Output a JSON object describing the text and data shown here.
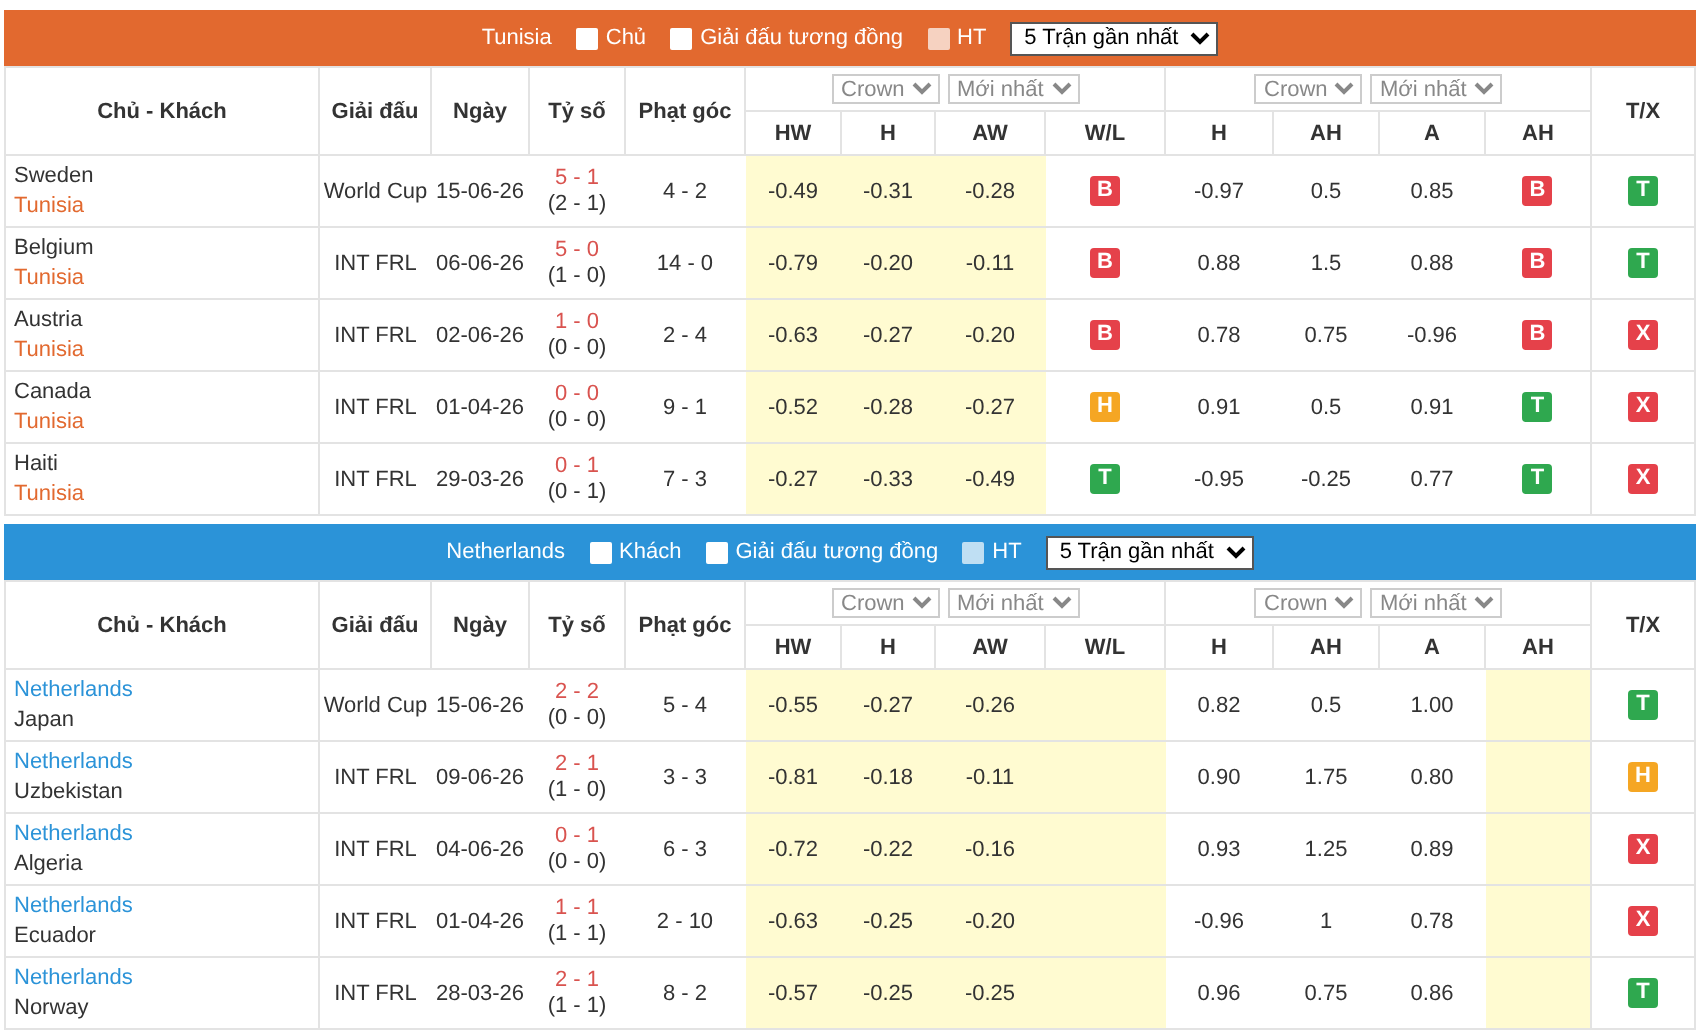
{
  "sections": [
    {
      "color": "#e2692f",
      "team": "Tunisia",
      "filters": [
        {
          "label": "Chủ",
          "checked": false,
          "disabled": false
        },
        {
          "label": "Giải đấu tương đồng",
          "checked": false,
          "disabled": false
        },
        {
          "label": "HT",
          "checked": false,
          "disabled": true
        }
      ],
      "range_select": "5 Trận gần nhất",
      "columns": [
        "Chủ - Khách",
        "Giải đấu",
        "Ngày",
        "Tỷ số",
        "Phạt góc"
      ],
      "odds_groups": [
        {
          "selects": [
            "Crown",
            "Mới nhất"
          ],
          "columns": [
            {
              "label": "HW",
              "highlighted": true
            },
            {
              "label": "H",
              "highlighted": true
            },
            {
              "label": "AW",
              "highlighted": true
            },
            {
              "label": "W/L",
              "highlighted": false
            }
          ]
        },
        {
          "selects": [
            "Crown",
            "Mới nhất"
          ],
          "columns": [
            {
              "label": "H",
              "highlighted": false
            },
            {
              "label": "AH",
              "highlighted": false
            },
            {
              "label": "A",
              "highlighted": false
            },
            {
              "label": "AH",
              "highlighted": false
            }
          ]
        }
      ],
      "total_column": "T/X",
      "rows": [
        {
          "home": {
            "name": "Sweden",
            "highlighted": false
          },
          "away": {
            "name": "Tunisia",
            "highlighted": true
          },
          "league": "World Cup",
          "date": "15-06-26",
          "score": "5 - 1",
          "half_time": "(2 - 1)",
          "corners": "4 - 2",
          "odds": [
            {
              "values": [
                "-0.49",
                "-0.31",
                "-0.28"
              ],
              "result": {
                "text": "B",
                "color": "#e5414a"
              }
            },
            {
              "values": [
                "-0.97",
                "0.5",
                "0.85"
              ],
              "result": {
                "text": "B",
                "color": "#e5414a"
              }
            }
          ],
          "total": {
            "text": "T",
            "color": "#2fa84f"
          }
        },
        {
          "home": {
            "name": "Belgium",
            "highlighted": false
          },
          "away": {
            "name": "Tunisia",
            "highlighted": true
          },
          "league": "INT FRL",
          "date": "06-06-26",
          "score": "5 - 0",
          "half_time": "(1 - 0)",
          "corners": "14 - 0",
          "odds": [
            {
              "values": [
                "-0.79",
                "-0.20",
                "-0.11"
              ],
              "result": {
                "text": "B",
                "color": "#e5414a"
              }
            },
            {
              "values": [
                "0.88",
                "1.5",
                "0.88"
              ],
              "result": {
                "text": "B",
                "color": "#e5414a"
              }
            }
          ],
          "total": {
            "text": "T",
            "color": "#2fa84f"
          }
        },
        {
          "home": {
            "name": "Austria",
            "highlighted": false
          },
          "away": {
            "name": "Tunisia",
            "highlighted": true
          },
          "league": "INT FRL",
          "date": "02-06-26",
          "score": "1 - 0",
          "half_time": "(0 - 0)",
          "corners": "2 - 4",
          "odds": [
            {
              "values": [
                "-0.63",
                "-0.27",
                "-0.20"
              ],
              "result": {
                "text": "B",
                "color": "#e5414a"
              }
            },
            {
              "values": [
                "0.78",
                "0.75",
                "-0.96"
              ],
              "result": {
                "text": "B",
                "color": "#e5414a"
              }
            }
          ],
          "total": {
            "text": "X",
            "color": "#e5414a"
          }
        },
        {
          "home": {
            "name": "Canada",
            "highlighted": false
          },
          "away": {
            "name": "Tunisia",
            "highlighted": true
          },
          "league": "INT FRL",
          "date": "01-04-26",
          "score": "0 - 0",
          "half_time": "(0 - 0)",
          "corners": "9 - 1",
          "odds": [
            {
              "values": [
                "-0.52",
                "-0.28",
                "-0.27"
              ],
              "result": {
                "text": "H",
                "color": "#f5a623"
              }
            },
            {
              "values": [
                "0.91",
                "0.5",
                "0.91"
              ],
              "result": {
                "text": "T",
                "color": "#2fa84f"
              }
            }
          ],
          "total": {
            "text": "X",
            "color": "#e5414a"
          }
        },
        {
          "home": {
            "name": "Haiti",
            "highlighted": false
          },
          "away": {
            "name": "Tunisia",
            "highlighted": true
          },
          "league": "INT FRL",
          "date": "29-03-26",
          "score": "0 - 1",
          "half_time": "(0 - 1)",
          "corners": "7 - 3",
          "odds": [
            {
              "values": [
                "-0.27",
                "-0.33",
                "-0.49"
              ],
              "result": {
                "text": "T",
                "color": "#2fa84f"
              }
            },
            {
              "values": [
                "-0.95",
                "-0.25",
                "0.77"
              ],
              "result": {
                "text": "T",
                "color": "#2fa84f"
              }
            }
          ],
          "total": {
            "text": "X",
            "color": "#e5414a"
          }
        }
      ]
    },
    {
      "color": "#2b93d8",
      "team": "Netherlands",
      "filters": [
        {
          "label": "Khách",
          "checked": false,
          "disabled": false
        },
        {
          "label": "Giải đấu tương đồng",
          "checked": false,
          "disabled": false
        },
        {
          "label": "HT",
          "checked": false,
          "disabled": true
        }
      ],
      "range_select": "5 Trận gần nhất",
      "columns": [
        "Chủ - Khách",
        "Giải đấu",
        "Ngày",
        "Tỷ số",
        "Phạt góc"
      ],
      "odds_groups": [
        {
          "selects": [
            "Crown",
            "Mới nhất"
          ],
          "columns": [
            {
              "label": "HW",
              "highlighted": true
            },
            {
              "label": "H",
              "highlighted": true
            },
            {
              "label": "AW",
              "highlighted": true
            },
            {
              "label": "W/L",
              "highlighted": true
            }
          ]
        },
        {
          "selects": [
            "Crown",
            "Mới nhất"
          ],
          "columns": [
            {
              "label": "H",
              "highlighted": false
            },
            {
              "label": "AH",
              "highlighted": false
            },
            {
              "label": "A",
              "highlighted": false
            },
            {
              "label": "AH",
              "highlighted": true
            }
          ]
        }
      ],
      "total_column": "T/X",
      "rows": [
        {
          "home": {
            "name": "Netherlands",
            "highlighted": true
          },
          "away": {
            "name": "Japan",
            "highlighted": false
          },
          "league": "World Cup",
          "date": "15-06-26",
          "score": "2 - 2",
          "half_time": "(0 - 0)",
          "corners": "5 - 4",
          "odds": [
            {
              "values": [
                "-0.55",
                "-0.27",
                "-0.26"
              ]
            },
            {
              "values": [
                "0.82",
                "0.5",
                "1.00"
              ]
            }
          ],
          "total": {
            "text": "T",
            "color": "#2fa84f"
          }
        },
        {
          "home": {
            "name": "Netherlands",
            "highlighted": true
          },
          "away": {
            "name": "Uzbekistan",
            "highlighted": false
          },
          "league": "INT FRL",
          "date": "09-06-26",
          "score": "2 - 1",
          "half_time": "(1 - 0)",
          "corners": "3 - 3",
          "odds": [
            {
              "values": [
                "-0.81",
                "-0.18",
                "-0.11"
              ]
            },
            {
              "values": [
                "0.90",
                "1.75",
                "0.80"
              ]
            }
          ],
          "total": {
            "text": "H",
            "color": "#f5a623"
          }
        },
        {
          "home": {
            "name": "Netherlands",
            "highlighted": true
          },
          "away": {
            "name": "Algeria",
            "highlighted": false
          },
          "league": "INT FRL",
          "date": "04-06-26",
          "score": "0 - 1",
          "half_time": "(0 - 0)",
          "corners": "6 - 3",
          "odds": [
            {
              "values": [
                "-0.72",
                "-0.22",
                "-0.16"
              ]
            },
            {
              "values": [
                "0.93",
                "1.25",
                "0.89"
              ]
            }
          ],
          "total": {
            "text": "X",
            "color": "#e5414a"
          }
        },
        {
          "home": {
            "name": "Netherlands",
            "highlighted": true
          },
          "away": {
            "name": "Ecuador",
            "highlighted": false
          },
          "league": "INT FRL",
          "date": "01-04-26",
          "score": "1 - 1",
          "half_time": "(1 - 1)",
          "corners": "2 - 10",
          "odds": [
            {
              "values": [
                "-0.63",
                "-0.25",
                "-0.20"
              ]
            },
            {
              "values": [
                "-0.96",
                "1",
                "0.78"
              ]
            }
          ],
          "total": {
            "text": "X",
            "color": "#e5414a"
          }
        },
        {
          "home": {
            "name": "Netherlands",
            "highlighted": true
          },
          "away": {
            "name": "Norway",
            "highlighted": false
          },
          "league": "INT FRL",
          "date": "28-03-26",
          "score": "2 - 1",
          "half_time": "(1 - 1)",
          "corners": "8 - 2",
          "odds": [
            {
              "values": [
                "-0.57",
                "-0.25",
                "-0.25"
              ]
            },
            {
              "values": [
                "0.96",
                "0.75",
                "0.86"
              ]
            }
          ],
          "total": {
            "text": "T",
            "color": "#2fa84f"
          }
        }
      ]
    }
  ]
}
